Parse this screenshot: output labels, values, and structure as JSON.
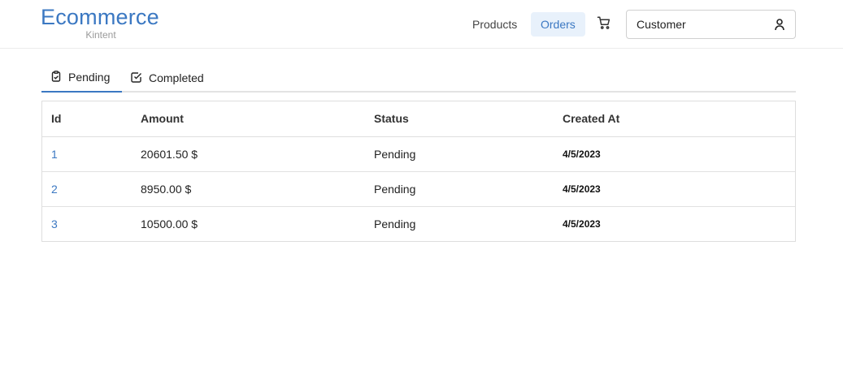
{
  "brand": {
    "title": "Ecommerce",
    "subtitle": "Kintent"
  },
  "nav": {
    "products_label": "Products",
    "orders_label": "Orders",
    "cart_icon": "cart-icon"
  },
  "account": {
    "label": "Customer",
    "icon": "user-icon"
  },
  "tabs": [
    {
      "label": "Pending",
      "icon": "clipboard-icon",
      "active": true
    },
    {
      "label": "Completed",
      "icon": "checkbox-icon",
      "active": false
    }
  ],
  "table": {
    "headers": {
      "id": "Id",
      "amount": "Amount",
      "status": "Status",
      "created_at": "Created At"
    },
    "rows": [
      {
        "id": "1",
        "amount": "20601.50 $",
        "status": "Pending",
        "created_at": "4/5/2023"
      },
      {
        "id": "2",
        "amount": "8950.00 $",
        "status": "Pending",
        "created_at": "4/5/2023"
      },
      {
        "id": "3",
        "amount": "10500.00 $",
        "status": "Pending",
        "created_at": "4/5/2023"
      }
    ]
  },
  "colors": {
    "accent": "#3b78c2",
    "active_nav_bg": "#e8f1fb",
    "muted": "#9a9a9a"
  }
}
